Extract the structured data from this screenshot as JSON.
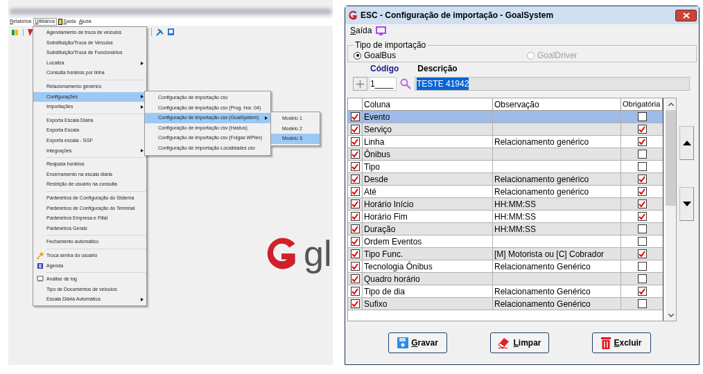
{
  "left_screen": {
    "menu_bar": [
      {
        "label": "Relatórios",
        "selected": false
      },
      {
        "label": "Utilitários",
        "selected": true
      },
      {
        "label": "Saída",
        "selected": false
      },
      {
        "label": "Ajuda",
        "selected": false
      }
    ],
    "menu": [
      [
        {
          "label": "Agendamento de troca de veículos",
          "submenu": false,
          "selected": false
        },
        {
          "label": "Substituição/Troca de Veículos",
          "submenu": false,
          "selected": false
        },
        {
          "label": "Substituição/Troca de Funcionários",
          "submenu": false,
          "selected": false
        },
        {
          "label": "Localiza",
          "submenu": true,
          "selected": false
        },
        {
          "label": "Consulta horários por linha",
          "submenu": false,
          "selected": false
        }
      ],
      [
        {
          "label": "Relacionamento genérico",
          "submenu": false,
          "selected": false
        },
        {
          "label": "Configurações",
          "submenu": true,
          "selected": true
        },
        {
          "label": "Importações",
          "submenu": true,
          "selected": false
        }
      ],
      [
        {
          "label": "Exporta Escala Diária",
          "submenu": false,
          "selected": false
        },
        {
          "label": "Exporta Escala",
          "submenu": false,
          "selected": false
        },
        {
          "label": "Exporta escala - SGF",
          "submenu": false,
          "selected": false
        },
        {
          "label": "Integrações",
          "submenu": true,
          "selected": false
        }
      ],
      [
        {
          "label": "Reajusta horários",
          "submenu": false,
          "selected": false
        },
        {
          "label": "Encerramento na escala diária",
          "submenu": false,
          "selected": false
        },
        {
          "label": "Restrição de usuário na consulta",
          "submenu": false,
          "selected": false
        }
      ],
      [
        {
          "label": "Parâmetros de Configuração do Sistema",
          "submenu": false,
          "selected": false
        },
        {
          "label": "Parâmetros de Configuração do Terminal",
          "submenu": false,
          "selected": false
        },
        {
          "label": "Parâmetros Empresa e Filial",
          "submenu": false,
          "selected": false
        },
        {
          "label": "Parâmetros Gerais",
          "submenu": false,
          "selected": false
        }
      ],
      [
        {
          "label": "Fechamento automático",
          "submenu": false,
          "selected": false
        }
      ],
      [
        {
          "label": "Troca senha do usuário",
          "submenu": false,
          "selected": false,
          "kind": "key"
        },
        {
          "label": "Agenda",
          "submenu": false,
          "selected": false,
          "kind": "book"
        }
      ],
      [
        {
          "label": "Análise de log",
          "submenu": false,
          "selected": false,
          "kind": "monitor"
        },
        {
          "label": "Tipo de Documentos de veículos",
          "submenu": false,
          "selected": false
        },
        {
          "label": "Escala Diária Automática",
          "submenu": true,
          "selected": false
        }
      ]
    ],
    "submenu": [
      {
        "label": "Configuração de importação csv",
        "submenu": false,
        "selected": false
      },
      {
        "label": "Configuração de importação csv (Prog. Hor. 04)",
        "submenu": false,
        "selected": false
      },
      {
        "label": "Configuração de importação csv (GoalSystem)",
        "submenu": true,
        "selected": true
      },
      {
        "label": "Configuração de importação csv (Hastus)",
        "submenu": false,
        "selected": false
      },
      {
        "label": "Configuração de importação csv (Folgas WPlex)",
        "submenu": false,
        "selected": false
      },
      {
        "label": "Configuração de Importação Localidades csv",
        "submenu": false,
        "selected": false
      }
    ],
    "submenu2": [
      {
        "label": "Modelo 1",
        "selected": false
      },
      {
        "label": "Modelo 2",
        "selected": false
      },
      {
        "label": "Modelo 3",
        "selected": true
      }
    ],
    "logo_text": "gl"
  },
  "dialog": {
    "title": "ESC - Configuração de importação - GoalSystem",
    "menu": "Saída",
    "import_type": {
      "legend": "Tipo de importação",
      "options": [
        {
          "label": "GoalBus",
          "selected": true,
          "disabled": false
        },
        {
          "label": "GoalDriver",
          "selected": false,
          "disabled": true
        }
      ]
    },
    "code": {
      "label": "Código",
      "value": "1____"
    },
    "description": {
      "label": "Descrição",
      "value": "TESTE 41942",
      "selected": true
    },
    "table": {
      "columns": [
        "Coluna",
        "Observação",
        "Obrigatória"
      ],
      "rows": [
        {
          "included": true,
          "column": "Evento",
          "note": "",
          "required": false,
          "selected": true
        },
        {
          "included": true,
          "column": "Serviço",
          "note": "",
          "required": true,
          "selected": false
        },
        {
          "included": true,
          "column": "Linha",
          "note": "Relacionamento genérico",
          "required": true,
          "selected": false
        },
        {
          "included": true,
          "column": "Ônibus",
          "note": "",
          "required": false,
          "selected": false
        },
        {
          "included": true,
          "column": "Tipo",
          "note": "",
          "required": false,
          "selected": false
        },
        {
          "included": true,
          "column": "Desde",
          "note": "Relacionamento genérico",
          "required": true,
          "selected": false
        },
        {
          "included": true,
          "column": "Até",
          "note": "Relacionamento genérico",
          "required": true,
          "selected": false
        },
        {
          "included": true,
          "column": "Horário Início",
          "note": "HH:MM:SS",
          "required": true,
          "selected": false
        },
        {
          "included": true,
          "column": "Horário Fim",
          "note": "HH:MM:SS",
          "required": true,
          "selected": false
        },
        {
          "included": true,
          "column": "Duração",
          "note": "HH:MM:SS",
          "required": false,
          "selected": false
        },
        {
          "included": true,
          "column": "Ordem Eventos",
          "note": "",
          "required": false,
          "selected": false
        },
        {
          "included": true,
          "column": "Tipo Func.",
          "note": "[M] Motorista ou [C] Cobrador",
          "required": true,
          "selected": false
        },
        {
          "included": true,
          "column": "Tecnologia Ônibus",
          "note": "Relacionamento Genérico",
          "required": false,
          "selected": false
        },
        {
          "included": true,
          "column": "Quadro horário",
          "note": "",
          "required": false,
          "selected": false
        },
        {
          "included": true,
          "column": "Tipo de dia",
          "note": "Relacionamento Genérico",
          "required": true,
          "selected": false
        },
        {
          "included": true,
          "column": "Sufixo",
          "note": "Relacionamento Genérico",
          "required": false,
          "selected": false
        }
      ]
    },
    "buttons": [
      {
        "label": "Gravar",
        "kind": "save"
      },
      {
        "label": "Limpar",
        "kind": "clear"
      },
      {
        "label": "Excluir",
        "kind": "delete"
      }
    ]
  }
}
